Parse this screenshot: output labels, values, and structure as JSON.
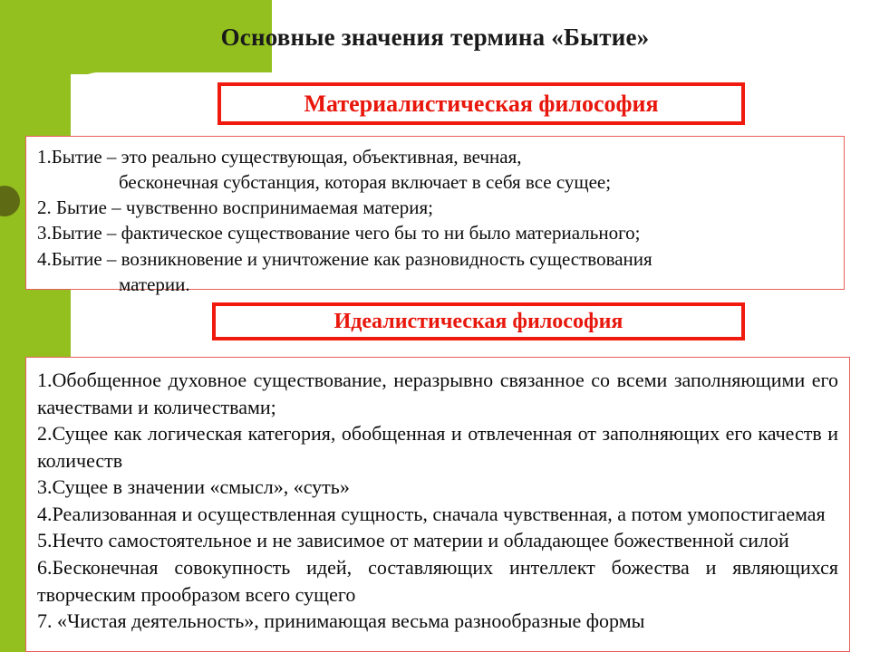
{
  "slide": {
    "title": "Основные значения термина «Бытие»",
    "accent_green": "#93C01F",
    "accent_red": "#E8170C",
    "box_border": "#E8605A"
  },
  "sections": [
    {
      "banner": "Материалистическая философия",
      "lines": [
        "1.Бытие – это реально существующая, объективная, вечная,",
        "бесконечная субстанция, которая включает в себя все сущее;",
        "2. Бытие – чувственно воспринимаемая материя;",
        "3.Бытие – фактическое существование чего бы то ни было материального;",
        "4.Бытие – возникновение и уничтожение как разновидность существования",
        "материи."
      ]
    },
    {
      "banner": "Идеалистическая философия",
      "items": [
        "1.Обобщенное духовное существование, неразрывно связанное со всеми заполняющими его качествами и количествами;",
        "2.Сущее как логическая категория, обобщенная и отвлеченная от заполняющих его качеств и количеств",
        "3.Сущее в значении «смысл», «суть»",
        "4.Реализованная и осуществленная сущность, сначала чувственная, а потом умопостигаемая",
        "5.Нечто самостоятельное и не зависимое от материи и обладающее божественной силой",
        "6.Бесконечная совокупность идей, составляющих интеллект божества и являющихся творческим прообразом всего сущего",
        "7. «Чистая деятельность», принимающая весьма разнообразные формы"
      ]
    }
  ]
}
